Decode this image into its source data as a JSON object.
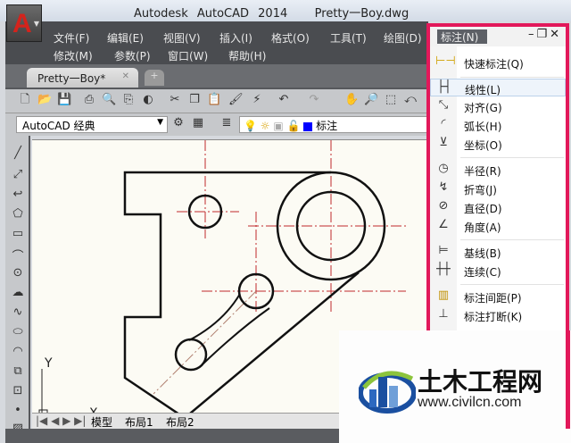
{
  "app": {
    "title": "Autodesk AutoCAD 2014",
    "file": "Pretty一Boy.dwg"
  },
  "menu": {
    "row1": [
      "文件(F)",
      "编辑(E)",
      "视图(V)",
      "插入(I)",
      "格式(O)",
      "工具(T)",
      "绘图(D)"
    ],
    "row2": [
      "修改(M)",
      "参数(P)",
      "窗口(W)",
      "帮助(H)"
    ]
  },
  "doc_tab": "Pretty一Boy*",
  "workspace": "AutoCAD 经典",
  "layer": {
    "name": "标注",
    "color": "#0000ff"
  },
  "axis": {
    "x": "X",
    "y": "Y"
  },
  "layout_tabs": [
    "模型",
    "布局1",
    "布局2"
  ],
  "panel": {
    "title": "标注(N)",
    "items": [
      {
        "label": "快速标注(Q)",
        "icon": "quick-dimension-icon"
      },
      {
        "label": "线性(L)",
        "icon": "linear-icon",
        "selected": true
      },
      {
        "label": "对齐(G)",
        "icon": "aligned-icon"
      },
      {
        "label": "弧长(H)",
        "icon": "arc-length-icon"
      },
      {
        "label": "坐标(O)",
        "icon": "ordinate-icon"
      },
      {
        "label": "半径(R)",
        "icon": "radius-icon"
      },
      {
        "label": "折弯(J)",
        "icon": "jogged-icon"
      },
      {
        "label": "直径(D)",
        "icon": "diameter-icon"
      },
      {
        "label": "角度(A)",
        "icon": "angular-icon"
      },
      {
        "label": "基线(B)",
        "icon": "baseline-icon"
      },
      {
        "label": "连续(C)",
        "icon": "continue-icon"
      },
      {
        "label": "标注间距(P)",
        "icon": "dim-space-icon"
      },
      {
        "label": "标注打断(K)",
        "icon": "dim-break-icon"
      }
    ]
  },
  "watermark": {
    "name": "土木工程网",
    "url": "www.civilcn.com"
  },
  "colors": {
    "accent": "#e2185a",
    "centerline": "#c0282d"
  }
}
